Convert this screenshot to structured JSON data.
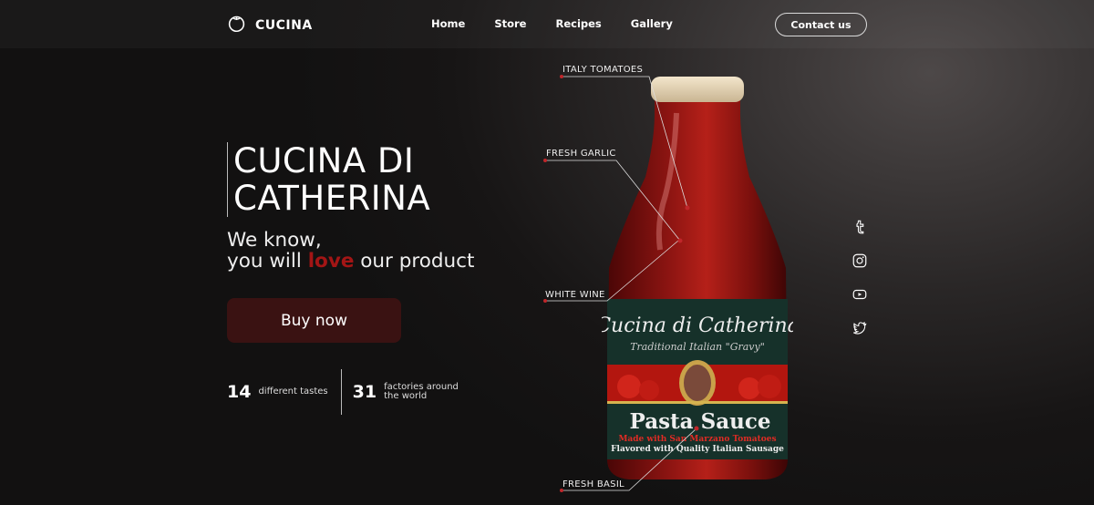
{
  "brand": {
    "name": "CUCINA",
    "logo_icon": "tomato-icon"
  },
  "nav": {
    "items": [
      "Home",
      "Store",
      "Recipes",
      "Gallery"
    ],
    "contact_label": "Contact us"
  },
  "hero": {
    "title_line1": "CUCINA DI",
    "title_line2": "CATHERINA",
    "tagline_line1": "We know,",
    "tagline_pre": "you will ",
    "tagline_love": "love",
    "tagline_post": " our product",
    "buy_label": "Buy now"
  },
  "stats": [
    {
      "number": "14",
      "label_line1": "different tastes",
      "label_line2": ""
    },
    {
      "number": "31",
      "label_line1": "factories around",
      "label_line2": "the world"
    }
  ],
  "product": {
    "label_title": "Cucina di Catherina",
    "label_subtitle": "Traditional Italian \"Gravy\"",
    "label_name": "Pasta Sauce",
    "label_line1": "Made with San Marzano Tomatoes",
    "label_line2": "Flavored with Quality Italian Sausage",
    "callouts": [
      "ITALY TOMATOES",
      "FRESH GARLIC",
      "WHITE WINE",
      "FRESH BASIL"
    ]
  },
  "social": [
    "tumblr-icon",
    "instagram-icon",
    "youtube-icon",
    "twitter-icon"
  ],
  "colors": {
    "accent": "#a31515",
    "button": "#3a1212",
    "background": "#1a1818"
  }
}
